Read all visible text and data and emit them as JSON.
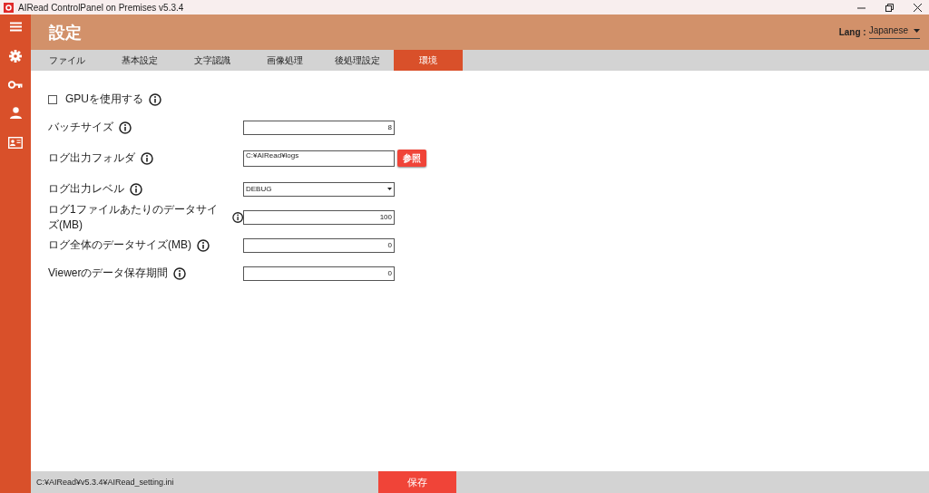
{
  "window": {
    "title": "AIRead ControlPanel on Premises v5.3.4"
  },
  "header": {
    "title": "設定",
    "lang_label": "Lang :",
    "lang_value": "Japanese"
  },
  "tabs": [
    {
      "label": "ファイル",
      "selected": false
    },
    {
      "label": "基本設定",
      "selected": false
    },
    {
      "label": "文字認識",
      "selected": false
    },
    {
      "label": "画像処理",
      "selected": false
    },
    {
      "label": "後処理設定",
      "selected": false
    },
    {
      "label": "環境",
      "selected": true
    }
  ],
  "settings": [
    {
      "kind": "checkbox",
      "label": "GPUを使用する",
      "checked": false
    },
    {
      "kind": "number",
      "label": "バッチサイズ",
      "value": "8"
    },
    {
      "kind": "folder",
      "label": "ログ出力フォルダ",
      "value": "C:¥AIRead¥logs",
      "button": "参照"
    },
    {
      "kind": "select",
      "label": "ログ出力レベル",
      "value": "DEBUG"
    },
    {
      "kind": "number",
      "label": "ログ1ファイルあたりのデータサイズ(MB)",
      "value": "100"
    },
    {
      "kind": "number",
      "label": "ログ全体のデータサイズ(MB)",
      "value": "0"
    },
    {
      "kind": "number",
      "label": "Viewerのデータ保存期間",
      "value": "0"
    }
  ],
  "footer": {
    "path": "C:¥AIRead¥v5.3.4¥AIRead_setting.ini",
    "save_button": "保存"
  }
}
